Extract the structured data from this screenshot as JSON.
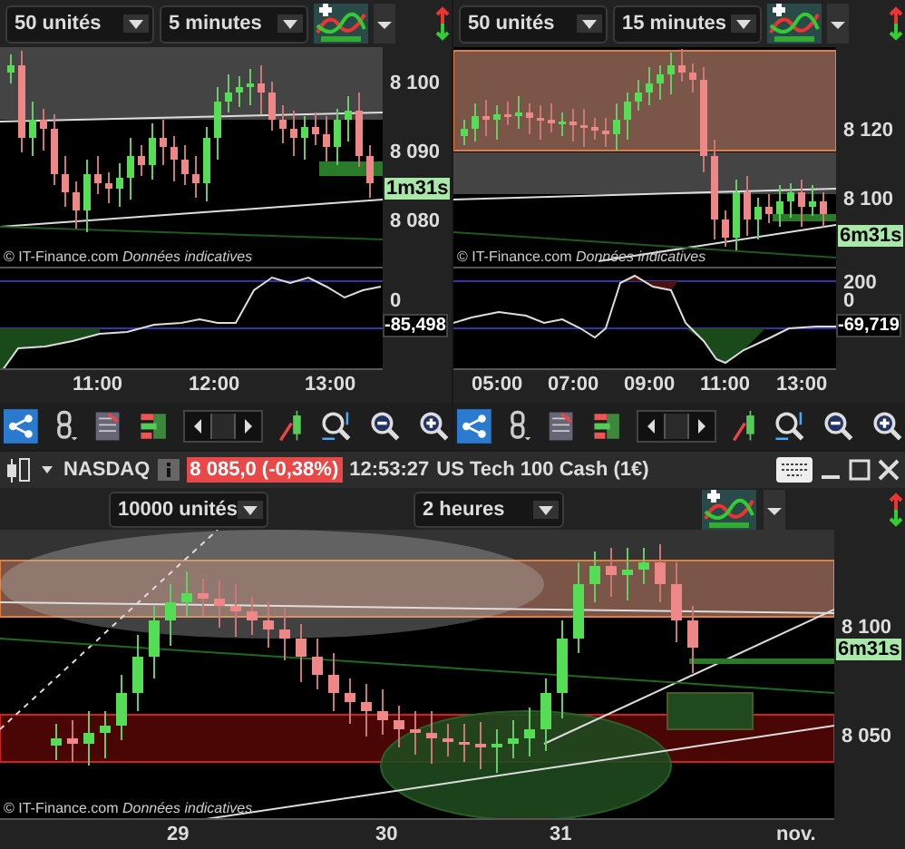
{
  "panels": [
    {
      "quantity": "50 unités",
      "timeframe": "5 minutes",
      "price_ticks": [
        "8 100",
        "8 090",
        "8 080"
      ],
      "countdown": "1m31s",
      "source": "© IT-Finance.com",
      "note": "Données indicatives",
      "oscillator_ticks": [
        "0"
      ],
      "oscillator_value": "-85,498",
      "time_ticks": [
        "11:00",
        "12:00",
        "13:00"
      ]
    },
    {
      "quantity": "50 unités",
      "timeframe": "15 minutes",
      "price_ticks": [
        "8 120",
        "8 100"
      ],
      "countdown": "6m31s",
      "source": "© IT-Finance.com",
      "note": "Données indicatives",
      "oscillator_ticks": [
        "200",
        "0"
      ],
      "oscillator_value": "-69,719",
      "time_ticks": [
        "05:00",
        "07:00",
        "09:00",
        "11:00",
        "13:00"
      ]
    }
  ],
  "main_window": {
    "symbol": "NASDAQ",
    "quote": "8 085,0 (-0,38%)",
    "time": "12:53:27",
    "instrument": "US Tech 100 Cash (1€)",
    "quantity": "10000 unités",
    "timeframe": "2 heures",
    "price_ticks": [
      "8 100",
      "8 050"
    ],
    "countdown": "6m31s",
    "source": "© IT-Finance.com",
    "note": "Données indicatives",
    "time_ticks": [
      "29",
      "30",
      "31",
      "nov."
    ]
  }
}
